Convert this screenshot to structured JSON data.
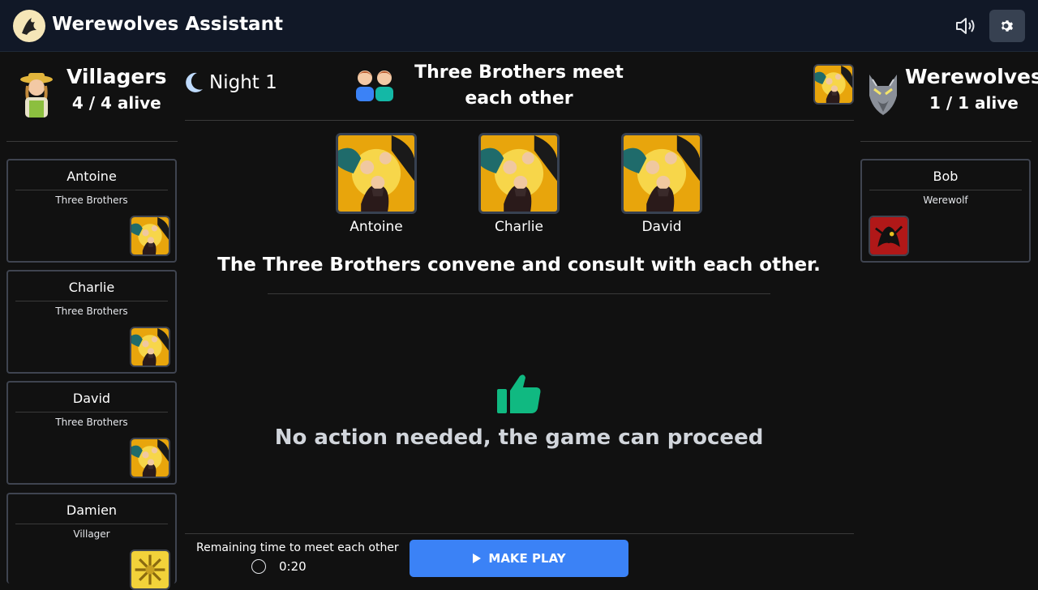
{
  "app": {
    "title": "Werewolves Assistant"
  },
  "colors": {
    "accent": "#3b82f6",
    "thumbs": "#10b981",
    "background": "#111111",
    "topbar": "#111827"
  },
  "villagers": {
    "title": "Villagers",
    "alive": "4 / 4 alive",
    "players": [
      {
        "name": "Antoine",
        "role": "Three Brothers",
        "icon": "three-brothers-card"
      },
      {
        "name": "Charlie",
        "role": "Three Brothers",
        "icon": "three-brothers-card"
      },
      {
        "name": "David",
        "role": "Three Brothers",
        "icon": "three-brothers-card"
      },
      {
        "name": "Damien",
        "role": "Villager",
        "icon": "villager-card"
      }
    ]
  },
  "werewolves": {
    "title": "Werewolves",
    "alive": "1 / 1 alive",
    "players": [
      {
        "name": "Bob",
        "role": "Werewolf",
        "icon": "werewolf-card"
      }
    ]
  },
  "turn": {
    "phase": "Night 1",
    "title": "Three Brothers meet each other",
    "participants": [
      "Antoine",
      "Charlie",
      "David"
    ],
    "description": "The Three Brothers convene and consult with each other.",
    "status": "No action needed, the game can proceed"
  },
  "timer": {
    "label": "Remaining time to meet each other",
    "value": "0:20"
  },
  "actions": {
    "make_play": "MAKE PLAY"
  }
}
